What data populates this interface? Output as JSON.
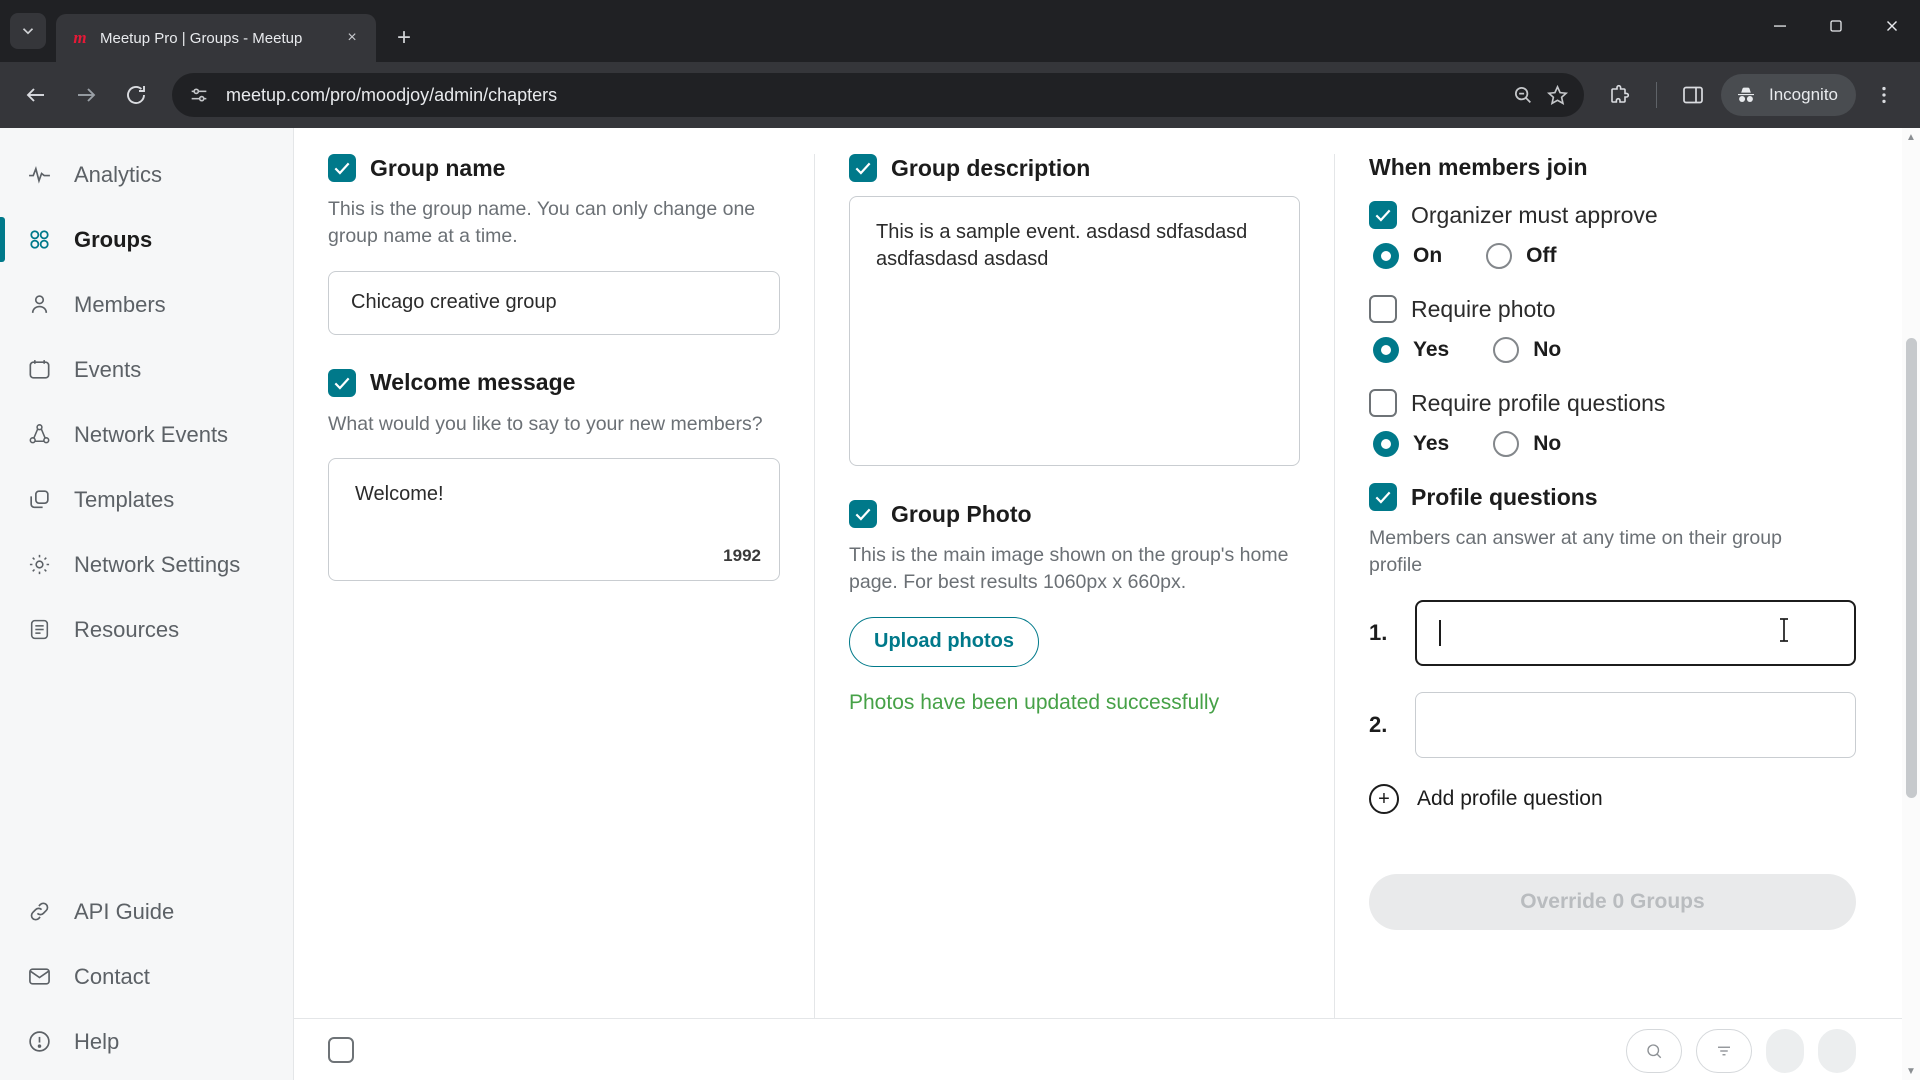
{
  "browser": {
    "tab": {
      "title": "Meetup Pro | Groups - Meetup",
      "favicon_letter": "m"
    },
    "new_tab_label": "+",
    "close_label": "×",
    "window_controls": {
      "minimize": "─",
      "maximize": "□",
      "close": "✕"
    },
    "omnibox": {
      "url": "meetup.com/pro/moodjoy/admin/chapters"
    },
    "profile": {
      "label": "Incognito"
    }
  },
  "sidebar": {
    "items": [
      {
        "label": "Analytics",
        "icon": "analytics-icon",
        "active": false
      },
      {
        "label": "Groups",
        "icon": "groups-icon",
        "active": true
      },
      {
        "label": "Members",
        "icon": "members-icon",
        "active": false
      },
      {
        "label": "Events",
        "icon": "events-icon",
        "active": false
      },
      {
        "label": "Network Events",
        "icon": "network-events-icon",
        "active": false
      },
      {
        "label": "Templates",
        "icon": "templates-icon",
        "active": false
      },
      {
        "label": "Network Settings",
        "icon": "gear-icon",
        "active": false
      },
      {
        "label": "Resources",
        "icon": "resources-icon",
        "active": false
      }
    ],
    "bottom_items": [
      {
        "label": "API Guide",
        "icon": "link-icon"
      },
      {
        "label": "Contact",
        "icon": "mail-icon"
      },
      {
        "label": "Help",
        "icon": "help-icon"
      }
    ]
  },
  "form": {
    "group_name": {
      "label": "Group name",
      "checked": true,
      "help": "This is the group name. You can only change one group name at a time.",
      "value": "Chicago creative group"
    },
    "welcome_message": {
      "label": "Welcome message",
      "checked": true,
      "help": "What would you like to say to your new members?",
      "value": "Welcome!",
      "counter": "1992"
    },
    "group_description": {
      "label": "Group description",
      "checked": true,
      "value": "This is a sample event. asdasd sdfasdasd asdfasdasd asdasd"
    },
    "group_photo": {
      "label": "Group Photo",
      "checked": true,
      "help": "This is the main image shown on the group's home page. For best results 1060px x 660px.",
      "upload_button": "Upload photos",
      "status_message": "Photos have been updated successfully",
      "status_color": "#46a147"
    },
    "when_members_join": {
      "title": "When members join",
      "organizer_approve": {
        "label": "Organizer must approve",
        "checked": true,
        "options": [
          "On",
          "Off"
        ],
        "selected": "On"
      },
      "require_photo": {
        "label": "Require photo",
        "checked": false,
        "options": [
          "Yes",
          "No"
        ],
        "selected": "Yes"
      },
      "require_profile_questions": {
        "label": "Require profile questions",
        "checked": false,
        "options": [
          "Yes",
          "No"
        ],
        "selected": "Yes"
      }
    },
    "profile_questions": {
      "label": "Profile questions",
      "checked": true,
      "help": "Members can answer at any time on their group profile",
      "questions": [
        {
          "num": "1.",
          "value": "",
          "focused": true
        },
        {
          "num": "2.",
          "value": "",
          "focused": false
        }
      ],
      "add_label": "Add profile question"
    },
    "override_button": {
      "label": "Override 0 Groups",
      "disabled": true
    }
  },
  "theme": {
    "accent": "#00798a",
    "success": "#46a147",
    "sidebar_bg": "#f6f7f8"
  }
}
